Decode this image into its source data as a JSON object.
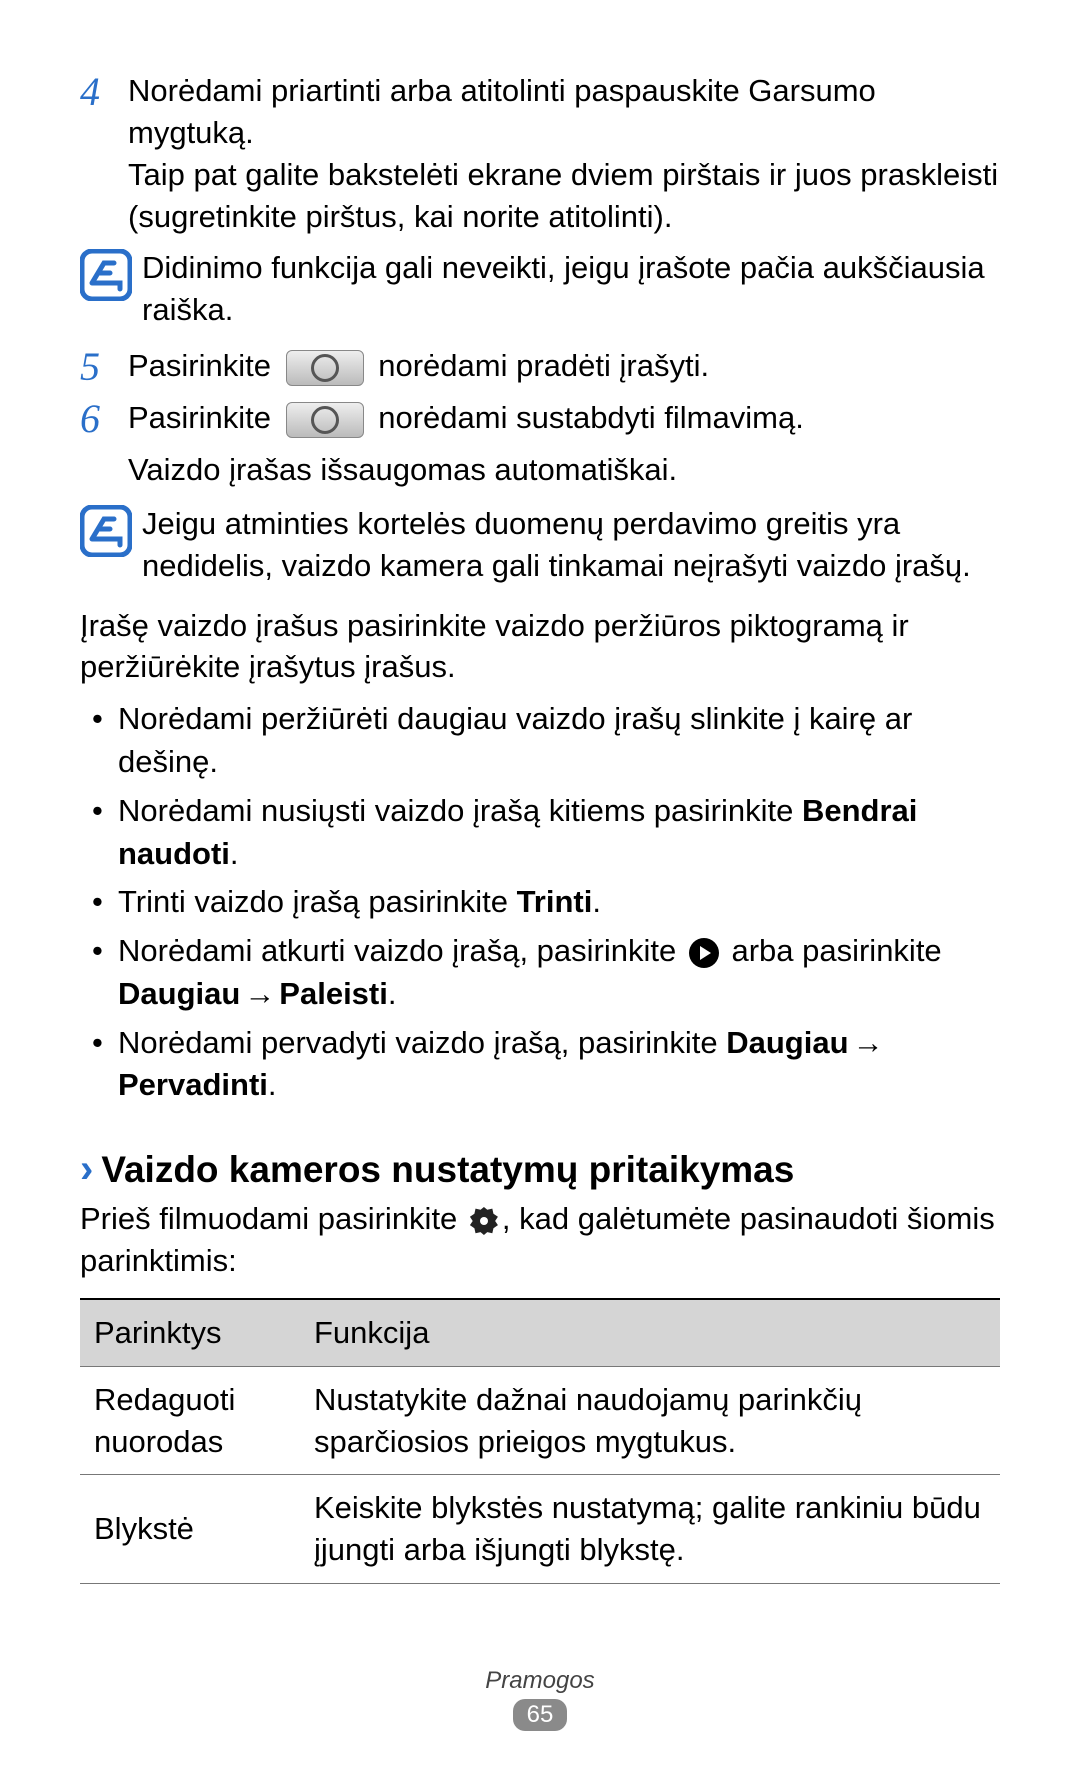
{
  "steps": {
    "s4": {
      "num": "4",
      "line1": "Norėdami priartinti arba atitolinti paspauskite Garsumo mygtuką.",
      "line2": "Taip pat galite bakstelėti ekrane dviem pirštais ir juos praskleisti (sugretinkite pirštus, kai norite atitolinti)."
    },
    "note1": "Didinimo funkcija gali neveikti, jeigu įrašote pačia aukščiausia raiška.",
    "s5": {
      "num": "5",
      "pre": "Pasirinkite",
      "post": "norėdami pradėti įrašyti."
    },
    "s6": {
      "num": "6",
      "pre": "Pasirinkite",
      "post": "norėdami sustabdyti filmavimą.",
      "sub": "Vaizdo įrašas išsaugomas automatiškai."
    },
    "note2": "Jeigu atminties kortelės duomenų perdavimo greitis yra nedidelis, vaizdo kamera gali tinkamai neįrašyti vaizdo įrašų."
  },
  "paragraph": "Įrašę vaizdo įrašus pasirinkite vaizdo peržiūros piktogramą ir peržiūrėkite įrašytus įrašus.",
  "bullets": {
    "b1": "Norėdami peržiūrėti daugiau vaizdo įrašų slinkite į kairę ar dešinę.",
    "b2_pre": "Norėdami nusiųsti vaizdo įrašą kitiems pasirinkite ",
    "b2_bold": "Bendrai naudoti",
    "b3_pre": "Trinti vaizdo įrašą pasirinkite ",
    "b3_bold": "Trinti",
    "b4_pre": "Norėdami atkurti vaizdo įrašą, pasirinkite ",
    "b4_mid": " arba pasirinkite ",
    "b4_bold1": "Daugiau",
    "b4_bold2": "Paleisti",
    "b5_pre": "Norėdami pervadyti vaizdo įrašą, pasirinkite ",
    "b5_bold1": "Daugiau",
    "b5_bold2": "Pervadinti"
  },
  "section": {
    "title": "Vaizdo kameros nustatymų pritaikymas",
    "intro_pre": "Prieš filmuodami pasirinkite ",
    "intro_post": ", kad galėtumėte pasinaudoti šiomis parinktimis:"
  },
  "table": {
    "h1": "Parinktys",
    "h2": "Funkcija",
    "r1c1": "Redaguoti nuorodas",
    "r1c2": "Nustatykite dažnai naudojamų parinkčių sparčiosios prieigos mygtukus.",
    "r2c1": "Blykstė",
    "r2c2": "Keiskite blykstės nustatymą; galite rankiniu būdu įjungti arba išjungti blykstę."
  },
  "footer": {
    "category": "Pramogos",
    "page": "65"
  },
  "glyphs": {
    "arrow": "→",
    "dot": "."
  }
}
